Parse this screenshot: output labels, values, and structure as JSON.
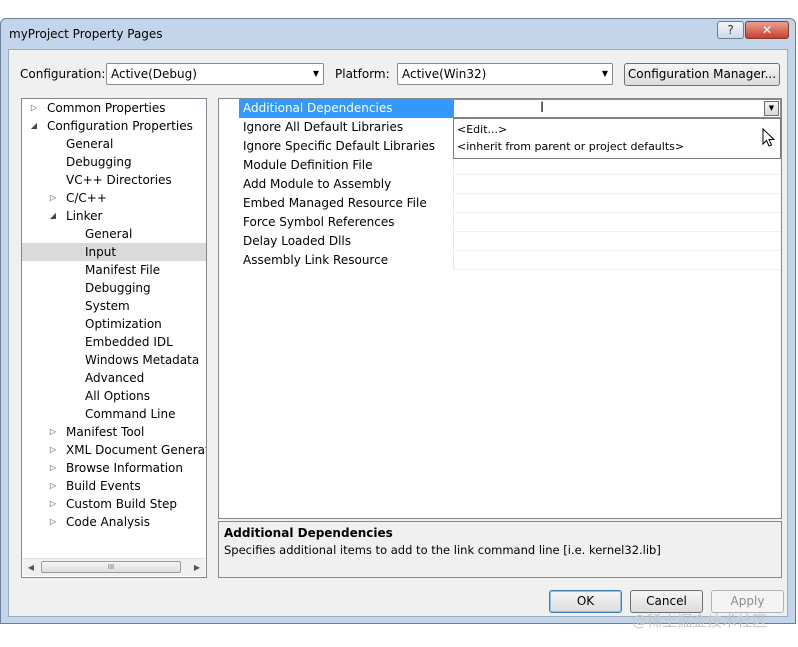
{
  "window": {
    "title": "myProject Property Pages",
    "help_glyph": "?",
    "close_glyph": "✕"
  },
  "toolbar": {
    "configuration_label": "Configuration:",
    "configuration_value": "Active(Debug)",
    "platform_label": "Platform:",
    "platform_value": "Active(Win32)",
    "config_manager_label": "Configuration Manager..."
  },
  "tree": {
    "items": [
      {
        "label": "Common Properties"
      },
      {
        "label": "Configuration Properties"
      },
      {
        "label": "General"
      },
      {
        "label": "Debugging"
      },
      {
        "label": "VC++ Directories"
      },
      {
        "label": "C/C++"
      },
      {
        "label": "Linker"
      },
      {
        "label": "General"
      },
      {
        "label": "Input"
      },
      {
        "label": "Manifest File"
      },
      {
        "label": "Debugging"
      },
      {
        "label": "System"
      },
      {
        "label": "Optimization"
      },
      {
        "label": "Embedded IDL"
      },
      {
        "label": "Windows Metadata"
      },
      {
        "label": "Advanced"
      },
      {
        "label": "All Options"
      },
      {
        "label": "Command Line"
      },
      {
        "label": "Manifest Tool"
      },
      {
        "label": "XML Document Generator"
      },
      {
        "label": "Browse Information"
      },
      {
        "label": "Build Events"
      },
      {
        "label": "Custom Build Step"
      },
      {
        "label": "Code Analysis"
      }
    ],
    "selected": "Input",
    "scrollbar_grip": "III"
  },
  "properties": {
    "rows": [
      {
        "name": "Additional Dependencies",
        "value": ""
      },
      {
        "name": "Ignore All Default Libraries",
        "value": ""
      },
      {
        "name": "Ignore Specific Default Libraries",
        "value": ""
      },
      {
        "name": "Module Definition File",
        "value": ""
      },
      {
        "name": "Add Module to Assembly",
        "value": ""
      },
      {
        "name": "Embed Managed Resource File",
        "value": ""
      },
      {
        "name": "Force Symbol References",
        "value": ""
      },
      {
        "name": "Delay Loaded Dlls",
        "value": ""
      },
      {
        "name": "Assembly Link Resource",
        "value": ""
      }
    ],
    "dropdown_options": [
      "<Edit...>",
      "<inherit from parent or project defaults>"
    ]
  },
  "description": {
    "title": "Additional Dependencies",
    "text": "Specifies additional items to add to the link command line [i.e. kernel32.lib]"
  },
  "buttons": {
    "ok": "OK",
    "cancel": "Cancel",
    "apply": "Apply"
  },
  "watermark": "@稀土掘金技术社区",
  "colors": {
    "selection": "#3399ff",
    "tree_selected": "#dadada"
  }
}
